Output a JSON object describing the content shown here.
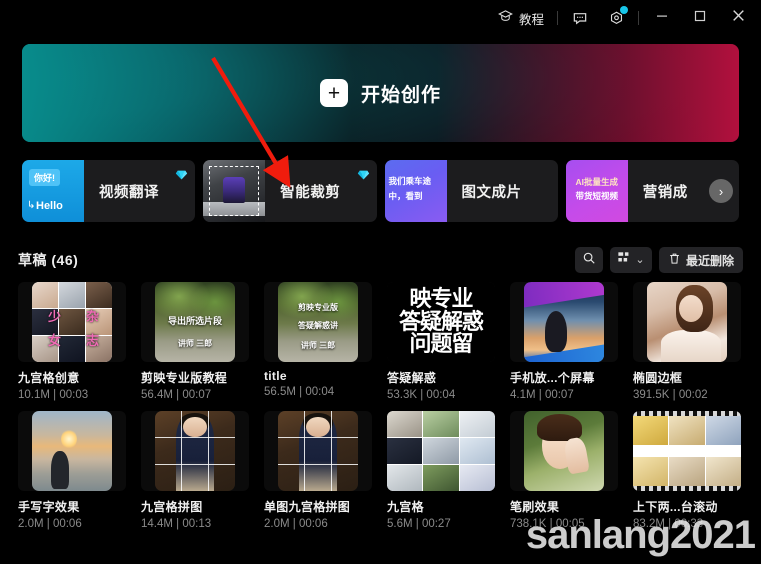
{
  "titlebar": {
    "tutorial_label": "教程",
    "icons": {
      "graduation": "graduation-cap-icon",
      "feedback": "message-icon",
      "settings": "gear-icon",
      "minimize": "minimize-icon",
      "maximize": "maximize-icon",
      "close": "close-icon"
    },
    "notification_dot_color": "#17c5e8"
  },
  "hero": {
    "label": "开始创作",
    "plus": "+",
    "gradient_start": "#0a8b8b",
    "gradient_end": "#c0113f"
  },
  "annotation": {
    "arrow_color": "#f01c0d",
    "points_to": "智能裁剪"
  },
  "features": {
    "cards": [
      {
        "title": "视频翻译",
        "badge": "gem-icon",
        "thumb_text_1": "你好!",
        "thumb_text_2": "Hello"
      },
      {
        "title": "智能裁剪",
        "badge": "gem-icon",
        "thumb_text_1": "",
        "thumb_text_2": ""
      },
      {
        "title": "图文成片",
        "badge": "",
        "thumb_text_1": "我们乘车途",
        "thumb_text_2": "中，看到"
      },
      {
        "title": "营销成",
        "badge": "",
        "thumb_text_1": "AI批量生成",
        "thumb_text_2": "带货短视频"
      }
    ],
    "next_arrow": "›"
  },
  "drafts": {
    "title": "草稿 (46)",
    "search_icon": "search-icon",
    "view_icon": "grid-view-icon",
    "view_chevron": "⌄",
    "trash_icon": "trash-icon",
    "trash_label": "最近删除",
    "items": [
      {
        "name": "九宫格创意",
        "size": "10.1M",
        "duration": "00:03",
        "meta": "10.1M | 00:03",
        "thumb": "mosaic-girls"
      },
      {
        "name": "剪映专业版教程",
        "size": "56.4M",
        "duration": "00:07",
        "meta": "56.4M | 00:07",
        "thumb": "forest-export",
        "overlay_1": "导出所选片段",
        "overlay_2": "讲师  三郎"
      },
      {
        "name": "title",
        "size": "56.5M",
        "duration": "00:04",
        "meta": "56.5M | 00:04",
        "thumb": "forest-title",
        "overlay_1": "剪映专业版",
        "overlay_2": "答疑解惑讲",
        "overlay_3": "讲师  三郎"
      },
      {
        "name": "答疑解惑",
        "size": "53.3K",
        "duration": "00:04",
        "meta": "53.3K | 00:04",
        "thumb": "big-text",
        "overlay_1": "映专业",
        "overlay_2": "答疑解惑",
        "overlay_3": "问题留"
      },
      {
        "name": "手机放...个屏幕",
        "size": "4.1M",
        "duration": "00:07",
        "meta": "4.1M | 00:07",
        "thumb": "phone-sunset"
      },
      {
        "name": "椭圆边框",
        "size": "391.5K",
        "duration": "00:02",
        "meta": "391.5K | 00:02",
        "thumb": "bride"
      },
      {
        "name": "手写字效果",
        "size": "2.0M",
        "duration": "00:06",
        "meta": "2.0M | 00:06",
        "thumb": "beach-sunset"
      },
      {
        "name": "九宫格拼图",
        "size": "14.4M",
        "duration": "00:13",
        "meta": "14.4M | 00:13",
        "thumb": "girl-grid"
      },
      {
        "name": "单图九宫格拼图",
        "size": "2.0M",
        "duration": "00:06",
        "meta": "2.0M | 00:06",
        "thumb": "girl-grid"
      },
      {
        "name": "九宫格",
        "size": "5.6M",
        "duration": "00:27",
        "meta": "5.6M | 00:27",
        "thumb": "mosaic-outdoor"
      },
      {
        "name": "笔刷效果",
        "size": "738.1K",
        "duration": "00:05",
        "meta": "738.1K | 00:05",
        "thumb": "praying-girl"
      },
      {
        "name": "上下两...台滚动",
        "size": "83.2M",
        "duration": "00:33",
        "meta": "83.2M | 00:33",
        "thumb": "film-strip"
      }
    ]
  },
  "watermark": {
    "text": "sanlang2021"
  }
}
